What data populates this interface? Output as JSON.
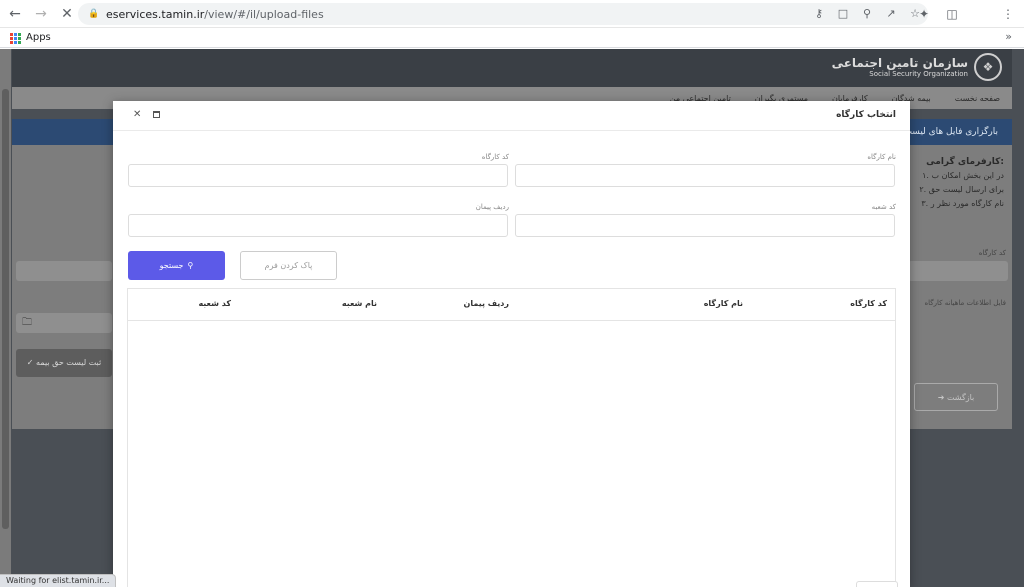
{
  "browser": {
    "url_host": "eservices.tamin.ir",
    "url_path": "/view/#/il/upload-files",
    "bookmarks_apps": "Apps",
    "status_text": "Waiting for elist.tamin.ir..."
  },
  "background_page": {
    "logo_fa": "سازمان تامین اجتماعی",
    "logo_en": "Social Security Organization",
    "nav": [
      "صفحه نخست",
      "بیمه شدگان",
      "کارفرمایان",
      "مستمری بگیران",
      "تامین اجتماعی من"
    ],
    "banner": "بارگزاری فایل های لیست",
    "info_title": "کارفرمای گرامی:",
    "info_lines": [
      "۱. در این بخش امکان ب",
      "۲. برای ارسال لیست حق",
      "۳. نام کارگاه مورد نظر ر"
    ],
    "label_workshop_code": "کد کارگاه",
    "label_file": "فایل اطلاعات ماهیانه کارگاه",
    "submit_label": "ثبت لیست حق بیمه",
    "back_label": "بازگشت"
  },
  "modal": {
    "title": "انتخاب کارگاه",
    "fields": {
      "workshop_name_label": "نام کارگاه",
      "workshop_code_label": "کد کارگاه",
      "branch_code_label": "کد شعبه",
      "contract_row_label": "ردیف پیمان"
    },
    "search_label": "جستجو",
    "clear_label": "پاک کردن فرم",
    "table_headers": [
      "کد کارگاه",
      "نام کارگاه",
      "ردیف پیمان",
      "نام شعبه",
      "کد شعبه"
    ]
  }
}
